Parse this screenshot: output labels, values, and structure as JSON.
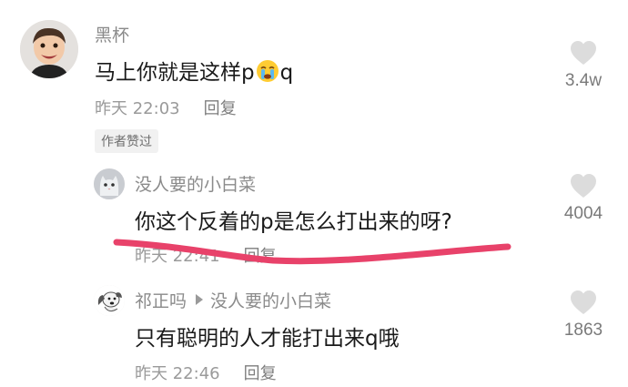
{
  "comments": [
    {
      "username": "黑杯",
      "text_before": "马上你就是这样p",
      "emoji": "crying-emoji",
      "text_after": "q",
      "time": "昨天 22:03",
      "reply_label": "回复",
      "likes": "3.4w",
      "badge": "作者赞过"
    },
    {
      "username": "没人要的小白菜",
      "text": "你这个反着的p是怎么打出来的呀?",
      "time": "昨天 22:41",
      "reply_label": "回复",
      "likes": "4004"
    },
    {
      "username": "祁正吗",
      "reply_to": "没人要的小白菜",
      "text": "只有聪明的人才能打出来q哦",
      "time": "昨天 22:46",
      "reply_label": "回复",
      "likes": "1863"
    }
  ],
  "colors": {
    "strike": "#e8426a",
    "heart": "#dcdcdc",
    "muted": "#9a9a9a"
  }
}
